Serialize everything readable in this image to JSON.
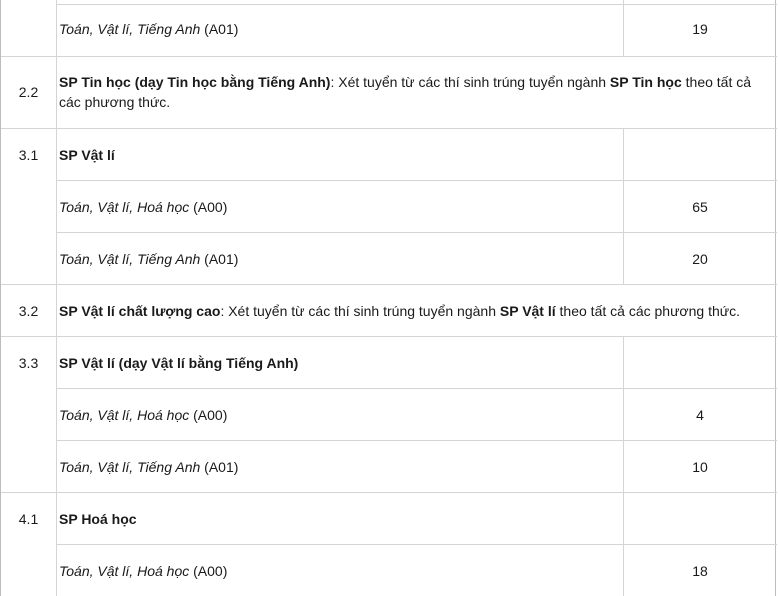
{
  "rows": [
    {
      "subject": "Toán, Vật lí, Tiếng Anh",
      "code": "(A01)",
      "value": "19"
    },
    {
      "number": "2.2",
      "title": "SP Tin học (dạy Tin học bằng Tiếng Anh)",
      "desc_a": ": Xét tuyển từ các thí sinh trúng tuyển ngành ",
      "ref": "SP Tin học",
      "desc_b": " theo tất cả",
      "desc_c": "các phương thức."
    },
    {
      "number": "3.1",
      "title": "SP Vật lí"
    },
    {
      "subject": "Toán, Vật lí, Hoá học",
      "code": "(A00)",
      "value": "65"
    },
    {
      "subject": "Toán, Vật lí, Tiếng Anh",
      "code": "(A01)",
      "value": "20"
    },
    {
      "number": "3.2",
      "title": "SP Vật lí chất lượng cao",
      "desc_a": ": Xét tuyển từ các thí sinh trúng tuyển ngành ",
      "ref": "SP Vật lí",
      "desc_b": " theo tất cả các phương thức."
    },
    {
      "number": "3.3",
      "title": "SP Vật lí (dạy Vật lí bằng Tiếng Anh)"
    },
    {
      "subject": "Toán, Vật lí, Hoá học",
      "code": "(A00)",
      "value": "4"
    },
    {
      "subject": "Toán, Vật lí, Tiếng Anh",
      "code": "(A01)",
      "value": "10"
    },
    {
      "number": "4.1",
      "title": "SP Hoá học"
    },
    {
      "subject": "Toán, Vật lí, Hoá học",
      "code": "(A00)",
      "value": "18"
    }
  ]
}
